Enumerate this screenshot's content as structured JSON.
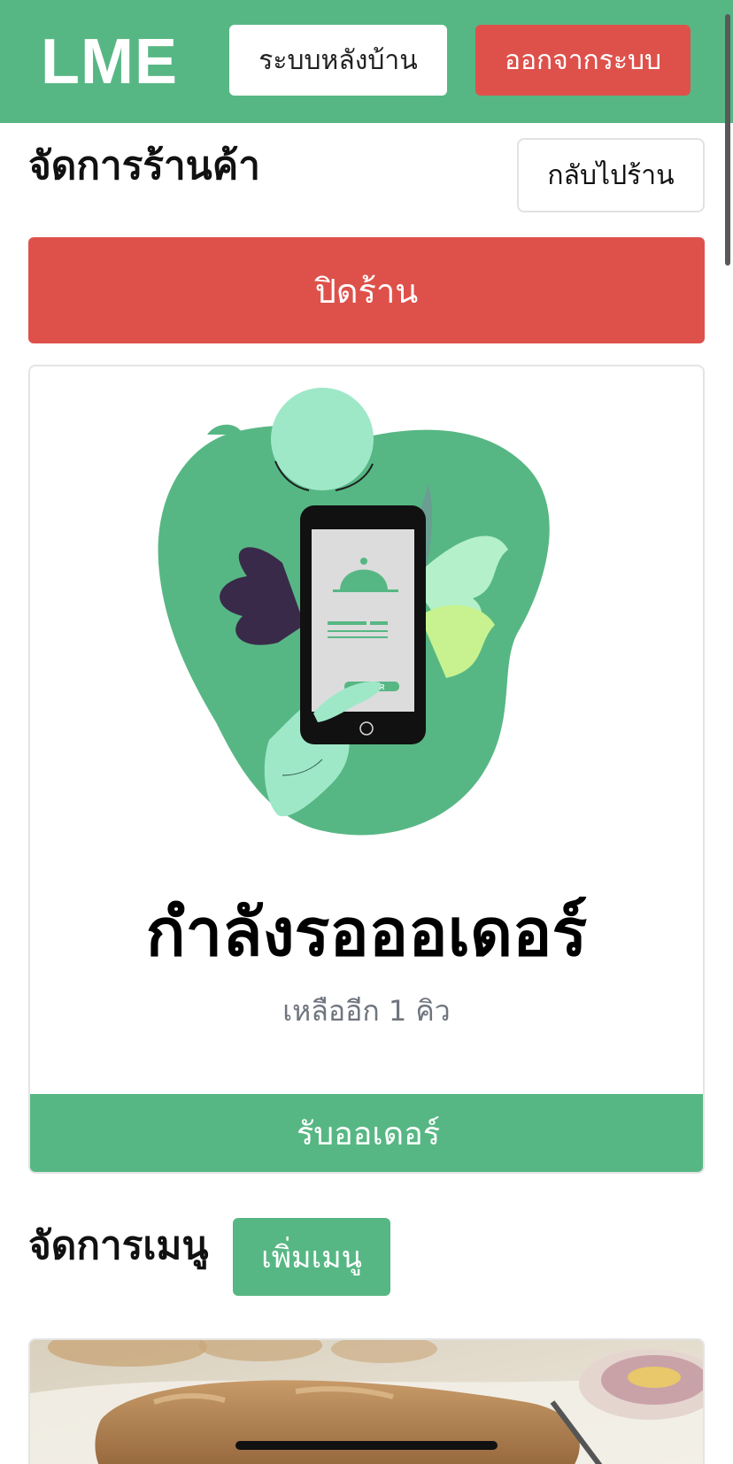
{
  "navbar": {
    "brand": "LME",
    "backoffice_label": "ระบบหลังบ้าน",
    "logout_label": "ออกจากระบบ"
  },
  "shop": {
    "title": "จัดการร้านค้า",
    "back_to_shop_label": "กลับไปร้าน",
    "close_shop_label": "ปิดร้าน"
  },
  "order_card": {
    "phone_button_text": "ORDER",
    "status": "กำลังรอออเดอร์",
    "queue": "เหลืออีก 1 คิว",
    "accept_label": "รับออเดอร์"
  },
  "menu": {
    "title": "จัดการเมนู",
    "add_label": "เพิ่มเมนู"
  },
  "colors": {
    "primary_green": "#57b784",
    "danger_red": "#de514b",
    "muted_text": "#6f757d"
  },
  "icons": [
    "phone-order-illustration",
    "bread-food-photo"
  ]
}
